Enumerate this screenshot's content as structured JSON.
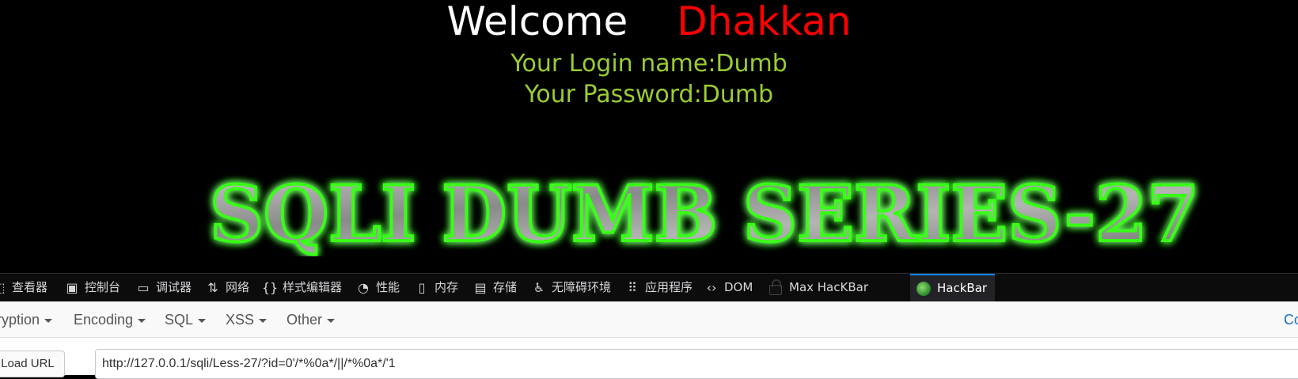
{
  "page": {
    "welcome_word": "Welcome",
    "welcome_name": "Dhakkan",
    "login_line": "Your Login name:Dumb",
    "password_line": "Your Password:Dumb",
    "banner_text": "SQLI DUMB SERIES-27",
    "colors": {
      "background": "#000000",
      "welcome": "#ffffff",
      "name": "#ff0000",
      "login_text": "#9acd32",
      "banner_glow": "#39ff14"
    }
  },
  "devtools": {
    "tabs": [
      {
        "label": "查看器",
        "icon": "inspector-icon"
      },
      {
        "label": "控制台",
        "icon": "console-icon"
      },
      {
        "label": "调试器",
        "icon": "debugger-icon"
      },
      {
        "label": "网络",
        "icon": "network-icon"
      },
      {
        "label": "样式编辑器",
        "icon": "style-editor-icon"
      },
      {
        "label": "性能",
        "icon": "performance-icon"
      },
      {
        "label": "内存",
        "icon": "memory-icon"
      },
      {
        "label": "存储",
        "icon": "storage-icon"
      },
      {
        "label": "无障碍环境",
        "icon": "accessibility-icon"
      },
      {
        "label": "应用程序",
        "icon": "application-icon"
      },
      {
        "label": "DOM",
        "icon": "dom-icon"
      },
      {
        "label": "Max HacKBar",
        "icon": "lock-icon"
      },
      {
        "label": "HackBar",
        "icon": "hackbar-logo-icon"
      }
    ],
    "active_tab": "HackBar"
  },
  "hackbar": {
    "menu": [
      {
        "label": "ryption"
      },
      {
        "label": "Encoding"
      },
      {
        "label": "SQL"
      },
      {
        "label": "XSS"
      },
      {
        "label": "Other"
      }
    ],
    "menu_right": "Co",
    "load_url_label": "Load URL",
    "url_value": "http://127.0.0.1/sqli/Less-27/?id=0'/*%0a*/||/*%0a*/'1"
  }
}
